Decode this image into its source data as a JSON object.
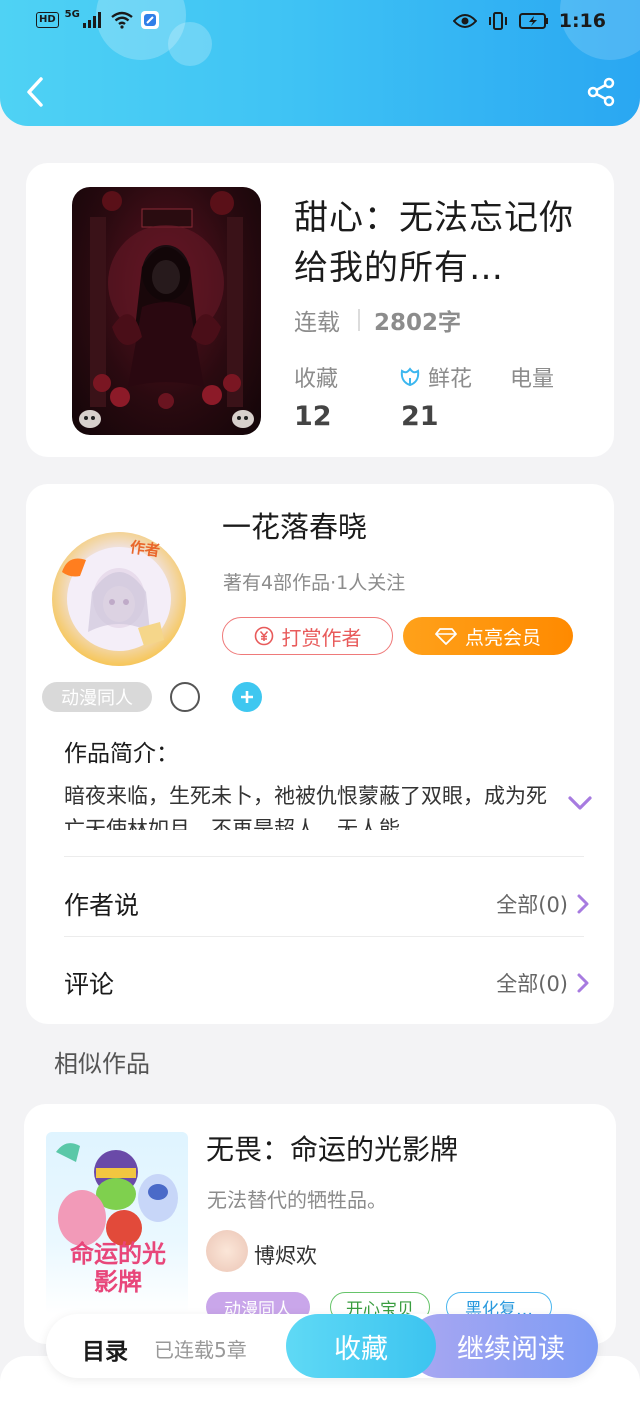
{
  "status_bar": {
    "network_badge": "HD",
    "network_type": "5G",
    "time": "1:16"
  },
  "header": {
    "back_icon": "chevron-left-icon",
    "share_icon": "share-icon"
  },
  "book": {
    "title": "甜心：无法忘记你给我的所有…",
    "status": "连载",
    "word_count": "2802字",
    "stats": [
      {
        "label": "收藏",
        "value": "12"
      },
      {
        "label": "鲜花",
        "value": "21",
        "icon": "flower-icon"
      },
      {
        "label": "电量",
        "value": ""
      }
    ]
  },
  "author": {
    "name": "一花落春晓",
    "summary": "著有4部作品·1人关注",
    "reward_label": "打赏作者",
    "vip_label": "点亮会员",
    "avatar_badge": "作者"
  },
  "work": {
    "category_tag": "动漫同人",
    "intro_title": "作品简介：",
    "intro_text": "暗夜来临，生死未卜，祂被仇恨蒙蔽了双眼，成为死亡天使林如月，不再是超人，无人能…",
    "author_says_label": "作者说",
    "author_says_link": "全部(0)",
    "comments_label": "评论",
    "comments_link": "全部(0)"
  },
  "similar": {
    "section_title": "相似作品",
    "items": [
      {
        "title": "无畏：命运的光影牌",
        "desc": "无法替代的牺牲品。",
        "author": "博烬欢",
        "cover_text": "命运的光影牌",
        "tags": [
          "动漫同人",
          "开心宝贝",
          "黑化复…"
        ]
      }
    ]
  },
  "bottom_bar": {
    "toc_label": "目录",
    "toc_status": "已连载5章",
    "collect_label": "收藏",
    "read_label": "继续阅读"
  },
  "colors": {
    "header_start": "#4fd2f4",
    "header_end": "#2aa7f2",
    "reward": "#e85b5b",
    "vip": "#ff8a00",
    "accent_purple": "#a77be0",
    "collect": "#3cc4f0",
    "read": "#8f9ff3"
  }
}
